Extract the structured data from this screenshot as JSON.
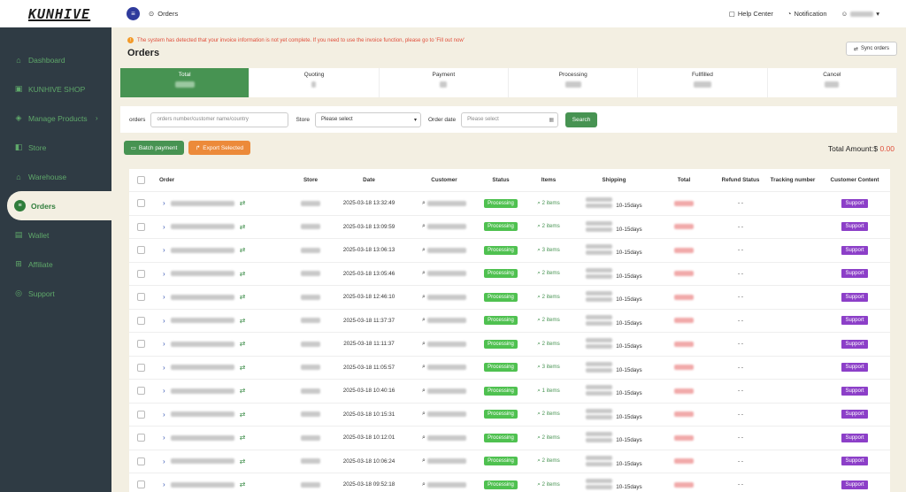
{
  "app": {
    "logo": "KUNHIVE"
  },
  "sidebar": {
    "items": [
      {
        "label": "Dashboard",
        "icon": "dashboard-icon"
      },
      {
        "label": "KUNHIVE SHOP",
        "icon": "shop-icon"
      },
      {
        "label": "Manage Products",
        "icon": "products-icon",
        "has_children": true
      },
      {
        "label": "Store",
        "icon": "store-icon"
      },
      {
        "label": "Warehouse",
        "icon": "warehouse-icon"
      },
      {
        "label": "Orders",
        "icon": "orders-icon",
        "active": true
      },
      {
        "label": "Wallet",
        "icon": "wallet-icon"
      },
      {
        "label": "Affiliate",
        "icon": "affiliate-icon"
      },
      {
        "label": "Support",
        "icon": "support-icon"
      }
    ]
  },
  "topbar": {
    "breadcrumb": "Orders",
    "help": "Help Center",
    "notification": "Notification"
  },
  "alert": {
    "text": "The system has detected that your invoice information is not yet complete. If you need to use the invoice function, please go to 'Fill out now'"
  },
  "page": {
    "title": "Orders",
    "sync_label": "Sync orders"
  },
  "status_tabs": [
    {
      "label": "Total",
      "active": true
    },
    {
      "label": "Quoting"
    },
    {
      "label": "Payment"
    },
    {
      "label": "Processing"
    },
    {
      "label": "Fullfilled"
    },
    {
      "label": "Cancel"
    }
  ],
  "filters": {
    "orders_label": "orders",
    "orders_placeholder": "orders number/customer name/country",
    "store_label": "Store",
    "store_value": "Please select",
    "date_label": "Order date",
    "date_placeholder": "Please select",
    "search_label": "Search"
  },
  "actions": {
    "batch_payment": "Batch payment",
    "export_selected": "Export Selected",
    "total_amount_label": "Total Amount:$",
    "total_amount_value": "0.00"
  },
  "table": {
    "headers": [
      "Order",
      "Store",
      "Date",
      "Customer",
      "Status",
      "Items",
      "Shipping",
      "Total",
      "Refund Status",
      "Tracking number",
      "Customer Content"
    ],
    "rows": [
      {
        "date": "2025-03-18 13:32:49",
        "status": "Processing",
        "items": "2 items",
        "shipping": "10-15days",
        "refund": "- -",
        "content": "Support"
      },
      {
        "date": "2025-03-18 13:09:59",
        "status": "Processing",
        "items": "2 items",
        "shipping": "10-15days",
        "refund": "- -",
        "content": "Support"
      },
      {
        "date": "2025-03-18 13:06:13",
        "status": "Processing",
        "items": "3 items",
        "shipping": "10-15days",
        "refund": "- -",
        "content": "Support"
      },
      {
        "date": "2025-03-18 13:05:46",
        "status": "Processing",
        "items": "2 items",
        "shipping": "10-15days",
        "refund": "- -",
        "content": "Support"
      },
      {
        "date": "2025-03-18 12:46:10",
        "status": "Processing",
        "items": "2 items",
        "shipping": "10-15days",
        "refund": "- -",
        "content": "Support"
      },
      {
        "date": "2025-03-18 11:37:37",
        "status": "Processing",
        "items": "2 items",
        "shipping": "10-15days",
        "refund": "- -",
        "content": "Support"
      },
      {
        "date": "2025-03-18 11:11:37",
        "status": "Processing",
        "items": "2 items",
        "shipping": "10-15days",
        "refund": "- -",
        "content": "Support"
      },
      {
        "date": "2025-03-18 11:05:57",
        "status": "Processing",
        "items": "3 items",
        "shipping": "10-15days",
        "refund": "- -",
        "content": "Support"
      },
      {
        "date": "2025-03-18 10:40:16",
        "status": "Processing",
        "items": "1 items",
        "shipping": "10-15days",
        "refund": "- -",
        "content": "Support"
      },
      {
        "date": "2025-03-18 10:15:31",
        "status": "Processing",
        "items": "2 items",
        "shipping": "10-15days",
        "refund": "- -",
        "content": "Support"
      },
      {
        "date": "2025-03-18 10:12:01",
        "status": "Processing",
        "items": "2 items",
        "shipping": "10-15days",
        "refund": "- -",
        "content": "Support"
      },
      {
        "date": "2025-03-18 10:06:24",
        "status": "Processing",
        "items": "2 items",
        "shipping": "10-15days",
        "refund": "- -",
        "content": "Support"
      },
      {
        "date": "2025-03-18 09:52:18",
        "status": "Processing",
        "items": "2 items",
        "shipping": "10-15days",
        "refund": "- -",
        "content": "Support"
      }
    ]
  },
  "colors": {
    "brand_green": "#479352",
    "sidebar_bg": "#2f3b44",
    "support_purple": "#8c3fc8",
    "alert_red": "#e04e3a",
    "export_orange": "#ec8a3a"
  }
}
